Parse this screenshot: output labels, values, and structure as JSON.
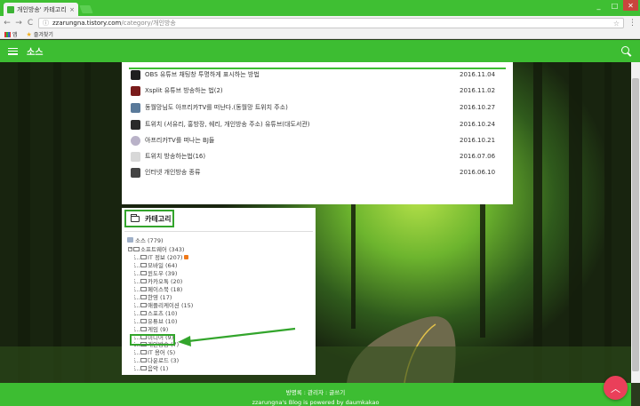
{
  "browser": {
    "tab_title": "개인방송' 카테고리의",
    "tab_close": "×",
    "url_host": "zzarungna.tistory.com",
    "url_path": "/category/개인방송",
    "back": "←",
    "forward": "→",
    "reload": "C",
    "bookmark_star": "☆",
    "menu": "⋮",
    "window": {
      "minimize": "_",
      "maximize": "□",
      "close": "✕"
    },
    "bookmarks": [
      {
        "label": "앱"
      },
      {
        "label": "즐겨찾기"
      }
    ]
  },
  "site": {
    "title": "소스"
  },
  "posts": [
    {
      "title": "OBS 유튜브 채팅창 투명하게 표시하는 방법",
      "date": "2016.11.04"
    },
    {
      "title": "Xsplit 유튜브 방송하는 법(2)",
      "date": "2016.11.02"
    },
    {
      "title": "동월망님도 아프리카TV를 떠난다.(동월망 트위치 주소)",
      "date": "2016.10.27"
    },
    {
      "title": "트위치 (서유리, 홍방장, 쉐리, 개인방송 주소) 유튜브(대도서관)",
      "date": "2016.10.24"
    },
    {
      "title": "아프리카TV를 떠나는 BJ들",
      "date": "2016.10.21"
    },
    {
      "title": "트위치 방송하는법(16)",
      "date": "2016.07.06"
    },
    {
      "title": "인터넷 개인방송 종류",
      "date": "2016.06.10"
    }
  ],
  "category": {
    "heading": "카테고리",
    "root": "소스 (779)",
    "items": [
      {
        "label": "소프트웨어 (343)",
        "level": 0,
        "expander": true
      },
      {
        "label": "IT 정보 (207)",
        "level": 1,
        "new": true
      },
      {
        "label": "모바일 (64)",
        "level": 1
      },
      {
        "label": "윈도우 (39)",
        "level": 1
      },
      {
        "label": "카카오톡 (20)",
        "level": 1
      },
      {
        "label": "페이스북 (18)",
        "level": 1
      },
      {
        "label": "한영 (17)",
        "level": 1
      },
      {
        "label": "애플리케이션 (15)",
        "level": 1
      },
      {
        "label": "스포츠 (10)",
        "level": 1
      },
      {
        "label": "유튜브 (10)",
        "level": 1
      },
      {
        "label": "게임 (9)",
        "level": 1
      },
      {
        "label": "미디어 (9)",
        "level": 1
      },
      {
        "label": "개인방송 (7)",
        "level": 1,
        "selected": true
      },
      {
        "label": "IT 용어 (5)",
        "level": 1
      },
      {
        "label": "다운로드 (3)",
        "level": 1
      },
      {
        "label": "음악 (1)",
        "level": 1
      }
    ]
  },
  "footer": {
    "line1": "방명록 : 관리자 : 글쓰기",
    "line2": "zzarungna's Blog is powered by daumkakao"
  },
  "fab_icon": "chevron-up-icon",
  "colors": {
    "brand_green": "#3dbd32",
    "highlight_green": "#33a52c",
    "fab": "#ea3f5a"
  }
}
